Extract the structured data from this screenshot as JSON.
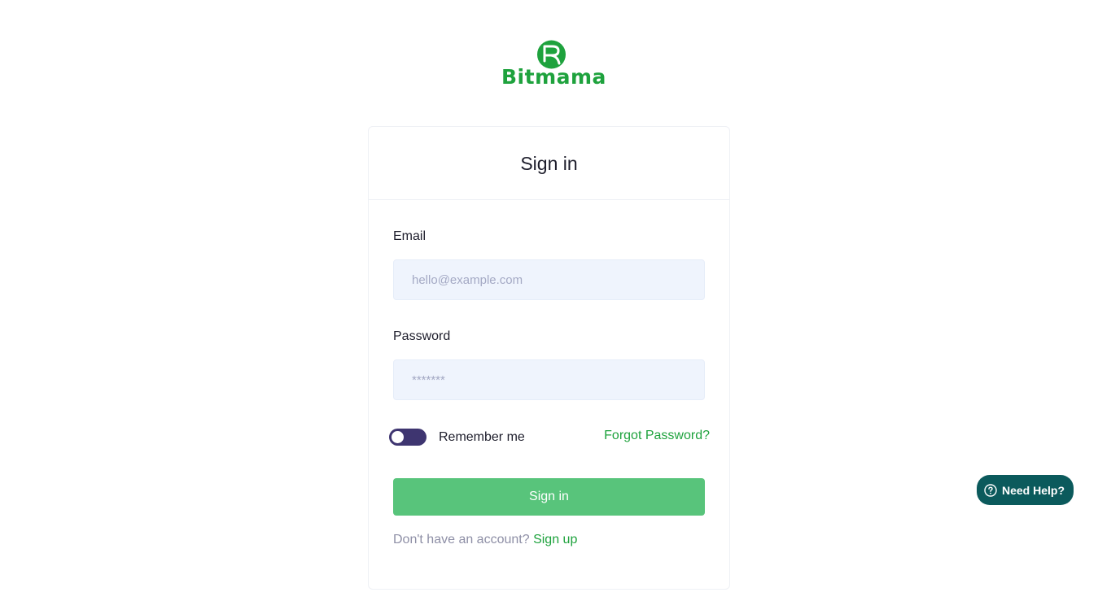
{
  "brand": {
    "name": "Bitmama",
    "color": "#1ea23d",
    "logo_icon": "bitmama-logo-icon"
  },
  "signin": {
    "title": "Sign in",
    "email_label": "Email",
    "email_placeholder": "hello@example.com",
    "email_value": "",
    "password_label": "Password",
    "password_placeholder": "*******",
    "password_value": "",
    "remember_label": "Remember me",
    "remember_checked": false,
    "forgot_label": "Forgot Password?",
    "submit_label": "Sign in",
    "no_account_text": "Don't have an account?",
    "signup_label": "Sign up"
  },
  "help": {
    "label": "Need Help?",
    "icon": "question-circle-icon"
  },
  "colors": {
    "accent": "#1ea23d",
    "button": "#58c47b",
    "toggle": "#3e3570",
    "input_bg": "#eff4fd",
    "help_bg": "#0b5a5c"
  }
}
